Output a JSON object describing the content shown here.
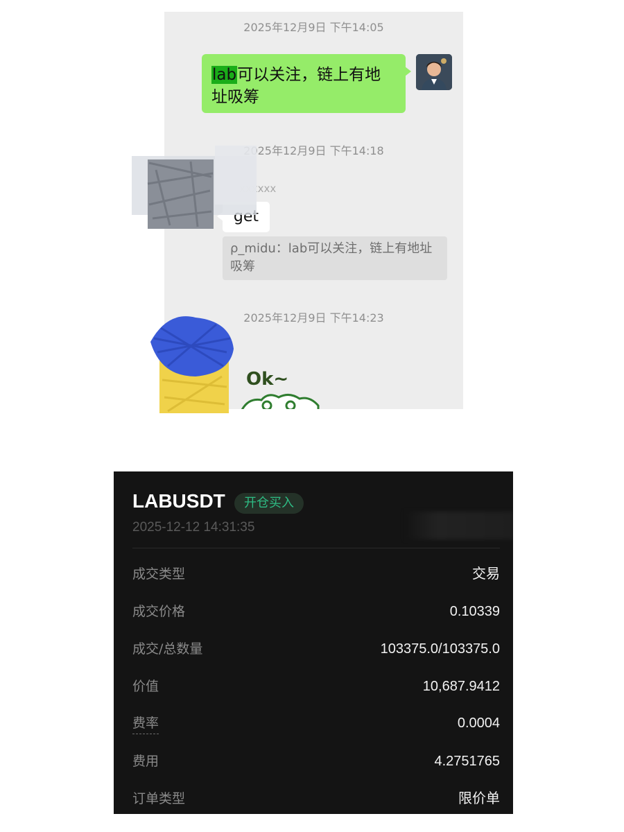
{
  "chat": {
    "timestamps": [
      "2025年12月9日 下午14:05",
      "2025年12月9日 下午14:18",
      "2025年12月9日 下午14:23"
    ],
    "my_message": {
      "highlight": "lab",
      "text": "可以关注，链上有地址吸筹"
    },
    "other_nickname": "xxxxxx",
    "reply_text": "get",
    "quote_text": "ρ_midu：lab可以关注，链上有地址吸筹",
    "sticker_text": "Ok~"
  },
  "trade": {
    "symbol": "LABUSDT",
    "side_badge": "开仓买入",
    "datetime": "2025-12-12 14:31:35",
    "rows": [
      {
        "label": "成交类型",
        "value": "交易"
      },
      {
        "label": "成交价格",
        "value": "0.10339"
      },
      {
        "label": "成交/总数量",
        "value": "103375.0/103375.0"
      },
      {
        "label": "价值",
        "value": "10,687.9412"
      },
      {
        "label": "费率",
        "value": "0.0004"
      },
      {
        "label": "费用",
        "value": "4.2751765"
      },
      {
        "label": "订单类型",
        "value": "限价单"
      }
    ]
  },
  "colors": {
    "my_bubble": "#95ec69",
    "highlight": "#1aad19",
    "badge_text": "#2ebd85",
    "trade_bg": "#141414"
  }
}
